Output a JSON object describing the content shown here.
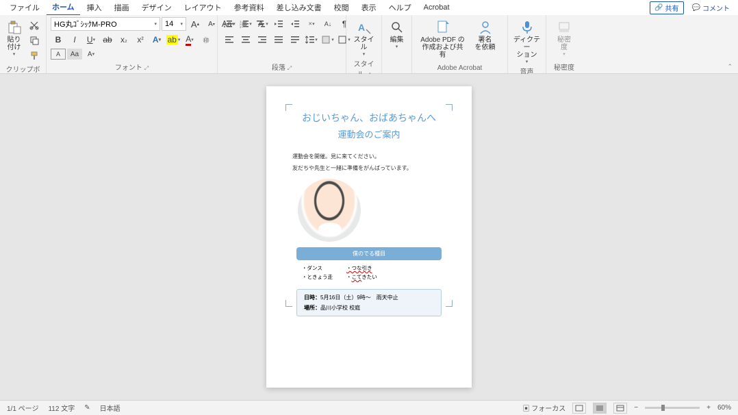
{
  "tabs": {
    "file": "ファイル",
    "home": "ホーム",
    "insert": "挿入",
    "draw": "描画",
    "design": "デザイン",
    "layout": "レイアウト",
    "references": "参考資料",
    "mailings": "差し込み文書",
    "review": "校閲",
    "view": "表示",
    "help": "ヘルプ",
    "acrobat": "Acrobat"
  },
  "topright": {
    "share": "共有",
    "comment": "コメント"
  },
  "ribbon": {
    "clipboard": {
      "paste": "貼り付け",
      "label": "クリップボード"
    },
    "font": {
      "name": "HG丸ｺﾞｼｯｸM-PRO",
      "size": "14",
      "label": "フォント"
    },
    "paragraph": {
      "label": "段落"
    },
    "styles": {
      "btn": "スタイル",
      "label": "スタイル"
    },
    "editing": {
      "btn": "編集"
    },
    "acrobat": {
      "createPdf": "Adobe PDF の\n作成および共有",
      "sign": "署名\nを依頼",
      "label": "Adobe Acrobat"
    },
    "voice": {
      "dictate": "ディクテー\nション",
      "label": "音声"
    },
    "sensitivity": {
      "btn": "秘密\n度",
      "label": "秘密度"
    }
  },
  "doc": {
    "title1": "おじいちゃん、おばあちゃんへ",
    "title2": "運動会のご案内",
    "p1": "運動会を開催。見に来てください。",
    "p2": "友だちや先生と一緒に準備をがんばっています。",
    "eventHeader": "僕のでる種目",
    "colA": [
      "・ダンス",
      "・ときょう走"
    ],
    "colB": [
      "・つな引き",
      "・こてきたい"
    ],
    "info1a": "日時：",
    "info1b": "5月16日（土）9時～　雨天中止",
    "info2a": "場所：",
    "info2b": "品川小学校 校庭"
  },
  "status": {
    "page": "1/1 ページ",
    "words": "112 文字",
    "lang": "日本語",
    "focus": "フォーカス",
    "zoom": "60%"
  }
}
